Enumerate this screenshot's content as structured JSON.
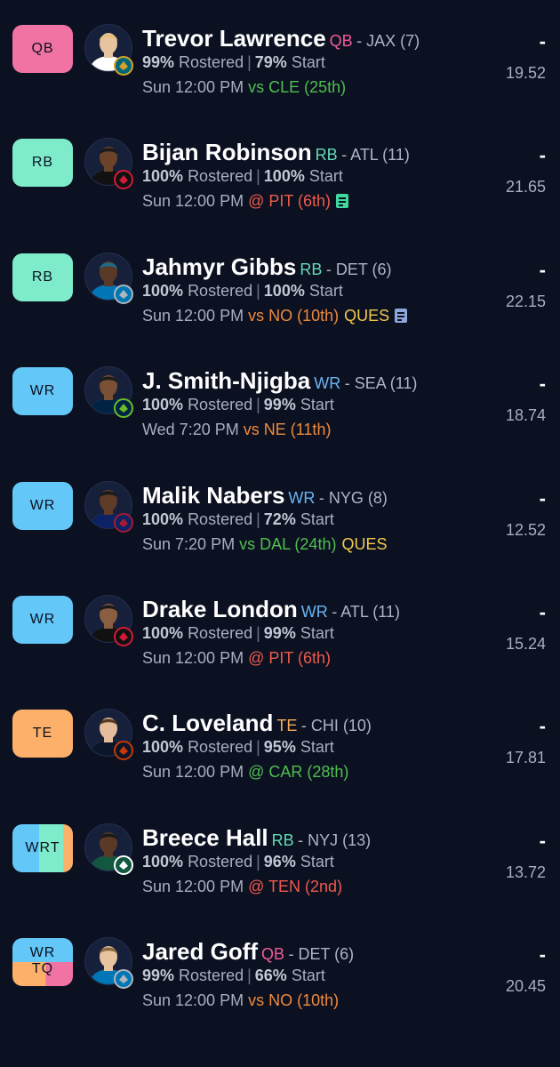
{
  "colors": {
    "background": "#0c1122",
    "qb": "#f073a3",
    "rb": "#7eeccb",
    "wr": "#63c7f7",
    "te": "#fdb069",
    "pos_qb_text": "#ee5c98",
    "pos_rb_text": "#63d9b5",
    "pos_wr_text": "#6ab5f2",
    "pos_te_text": "#f6ad5c",
    "matchup_good": "#4fbf4f",
    "matchup_neutral": "#f08a3c",
    "matchup_bad": "#ef5a4b",
    "status_ques": "#f2c94c"
  },
  "players": [
    {
      "slot": {
        "labels": [
          "QB"
        ],
        "colors": [
          "#f073a3"
        ]
      },
      "name": "Trevor Lawrence",
      "pos": "QB",
      "pos_color": "#ee5c98",
      "team_info": "- JAX (7)",
      "rostered_pct": "99%",
      "rostered_label": "Rostered",
      "start_pct": "79%",
      "start_label": "Start",
      "time": "Sun 12:00 PM",
      "matchup": "vs CLE (25th)",
      "matchup_color": "#4fbf4f",
      "status": "",
      "news_icon": "",
      "dash": "-",
      "points": "19.52",
      "team_icon": "jaguars-logo-icon",
      "team_colors": [
        "#006778",
        "#d7a22a"
      ],
      "jersey": "#ffffff",
      "skin": "#e8c3a0",
      "hair": "#e6c07a"
    },
    {
      "slot": {
        "labels": [
          "RB"
        ],
        "colors": [
          "#7eeccb"
        ]
      },
      "name": "Bijan Robinson",
      "pos": "RB",
      "pos_color": "#63d9b5",
      "team_info": "- ATL (11)",
      "rostered_pct": "100%",
      "rostered_label": "Rostered",
      "start_pct": "100%",
      "start_label": "Start",
      "time": "Sun 12:00 PM",
      "matchup": "@ PIT (6th)",
      "matchup_color": "#ef5a4b",
      "status": "",
      "news_icon": "#3fd9a0",
      "dash": "-",
      "points": "21.65",
      "team_icon": "falcons-logo-icon",
      "team_colors": [
        "#111111",
        "#d31a38"
      ],
      "jersey": "#111111",
      "skin": "#6b4329",
      "hair": "#1a1a1a"
    },
    {
      "slot": {
        "labels": [
          "RB"
        ],
        "colors": [
          "#7eeccb"
        ]
      },
      "name": "Jahmyr Gibbs",
      "pos": "RB",
      "pos_color": "#63d9b5",
      "team_info": "- DET (6)",
      "rostered_pct": "100%",
      "rostered_label": "Rostered",
      "start_pct": "100%",
      "start_label": "Start",
      "time": "Sun 12:00 PM",
      "matchup": "vs NO (10th)",
      "matchup_color": "#f08a3c",
      "status": "QUES",
      "news_icon": "#8fa6d8",
      "dash": "-",
      "points": "22.15",
      "team_icon": "lions-logo-icon",
      "team_colors": [
        "#0076b6",
        "#b0b7bc"
      ],
      "jersey": "#0076b6",
      "skin": "#5a3a26",
      "hair": "#1f6a8a"
    },
    {
      "slot": {
        "labels": [
          "WR"
        ],
        "colors": [
          "#63c7f7"
        ]
      },
      "name": "J. Smith-Njigba",
      "pos": "WR",
      "pos_color": "#6ab5f2",
      "team_info": "- SEA (11)",
      "rostered_pct": "100%",
      "rostered_label": "Rostered",
      "start_pct": "99%",
      "start_label": "Start",
      "time": "Wed 7:20 PM",
      "matchup": "vs NE (11th)",
      "matchup_color": "#f08a3c",
      "status": "",
      "news_icon": "",
      "dash": "-",
      "points": "18.74",
      "team_icon": "seahawks-logo-icon",
      "team_colors": [
        "#002244",
        "#69be28"
      ],
      "jersey": "#002244",
      "skin": "#7a5035",
      "hair": "#1a1a1a"
    },
    {
      "slot": {
        "labels": [
          "WR"
        ],
        "colors": [
          "#63c7f7"
        ]
      },
      "name": "Malik Nabers",
      "pos": "WR",
      "pos_color": "#6ab5f2",
      "team_info": "- NYG (8)",
      "rostered_pct": "100%",
      "rostered_label": "Rostered",
      "start_pct": "72%",
      "start_label": "Start",
      "time": "Sun 7:20 PM",
      "matchup": "vs DAL (24th)",
      "matchup_color": "#4fbf4f",
      "status": "QUES",
      "news_icon": "",
      "dash": "-",
      "points": "12.52",
      "team_icon": "giants-logo-icon",
      "team_colors": [
        "#0b2265",
        "#a71930"
      ],
      "jersey": "#0b2265",
      "skin": "#5e3c27",
      "hair": "#1a1a1a"
    },
    {
      "slot": {
        "labels": [
          "WR"
        ],
        "colors": [
          "#63c7f7"
        ]
      },
      "name": "Drake London",
      "pos": "WR",
      "pos_color": "#6ab5f2",
      "team_info": "- ATL (11)",
      "rostered_pct": "100%",
      "rostered_label": "Rostered",
      "start_pct": "99%",
      "start_label": "Start",
      "time": "Sun 12:00 PM",
      "matchup": "@ PIT (6th)",
      "matchup_color": "#ef5a4b",
      "status": "",
      "news_icon": "",
      "dash": "-",
      "points": "15.24",
      "team_icon": "falcons-logo-icon",
      "team_colors": [
        "#111111",
        "#d31a38"
      ],
      "jersey": "#111111",
      "skin": "#8a5e40",
      "hair": "#1a1a1a"
    },
    {
      "slot": {
        "labels": [
          "TE"
        ],
        "colors": [
          "#fdb069"
        ]
      },
      "name": "C. Loveland",
      "pos": "TE",
      "pos_color": "#f6ad5c",
      "team_info": "- CHI (10)",
      "rostered_pct": "100%",
      "rostered_label": "Rostered",
      "start_pct": "95%",
      "start_label": "Start",
      "time": "Sun 12:00 PM",
      "matchup": "@ CAR (28th)",
      "matchup_color": "#4fbf4f",
      "status": "",
      "news_icon": "",
      "dash": "-",
      "points": "17.81",
      "team_icon": "bears-logo-icon",
      "team_colors": [
        "#0b162a",
        "#c83803"
      ],
      "jersey": "#0b162a",
      "skin": "#e4bd9c",
      "hair": "#5a3b22"
    },
    {
      "slot": {
        "labels": [
          "WRT"
        ],
        "colors": [
          "#63c7f7",
          "#7eeccb",
          "#fdb069"
        ]
      },
      "name": "Breece Hall",
      "pos": "RB",
      "pos_color": "#63d9b5",
      "team_info": "- NYJ (13)",
      "rostered_pct": "100%",
      "rostered_label": "Rostered",
      "start_pct": "96%",
      "start_label": "Start",
      "time": "Sun 12:00 PM",
      "matchup": "@ TEN (2nd)",
      "matchup_color": "#ef5a4b",
      "status": "",
      "news_icon": "",
      "dash": "-",
      "points": "13.72",
      "team_icon": "jets-logo-icon",
      "team_colors": [
        "#125740",
        "#ffffff"
      ],
      "jersey": "#125740",
      "skin": "#5a3a26",
      "hair": "#1a1a1a"
    },
    {
      "slot": {
        "labels": [
          "WR",
          "TQ"
        ],
        "colors": [
          "#63c7f7",
          "#7eeccb",
          "#fdb069",
          "#f073a3"
        ]
      },
      "name": "Jared Goff",
      "pos": "QB",
      "pos_color": "#ee5c98",
      "team_info": "- DET (6)",
      "rostered_pct": "99%",
      "rostered_label": "Rostered",
      "start_pct": "66%",
      "start_label": "Start",
      "time": "Sun 12:00 PM",
      "matchup": "vs NO (10th)",
      "matchup_color": "#f08a3c",
      "status": "",
      "news_icon": "",
      "dash": "-",
      "points": "20.45",
      "team_icon": "lions-logo-icon",
      "team_colors": [
        "#0076b6",
        "#b0b7bc"
      ],
      "jersey": "#0076b6",
      "skin": "#e8c3a0",
      "hair": "#8a6a3e"
    }
  ]
}
